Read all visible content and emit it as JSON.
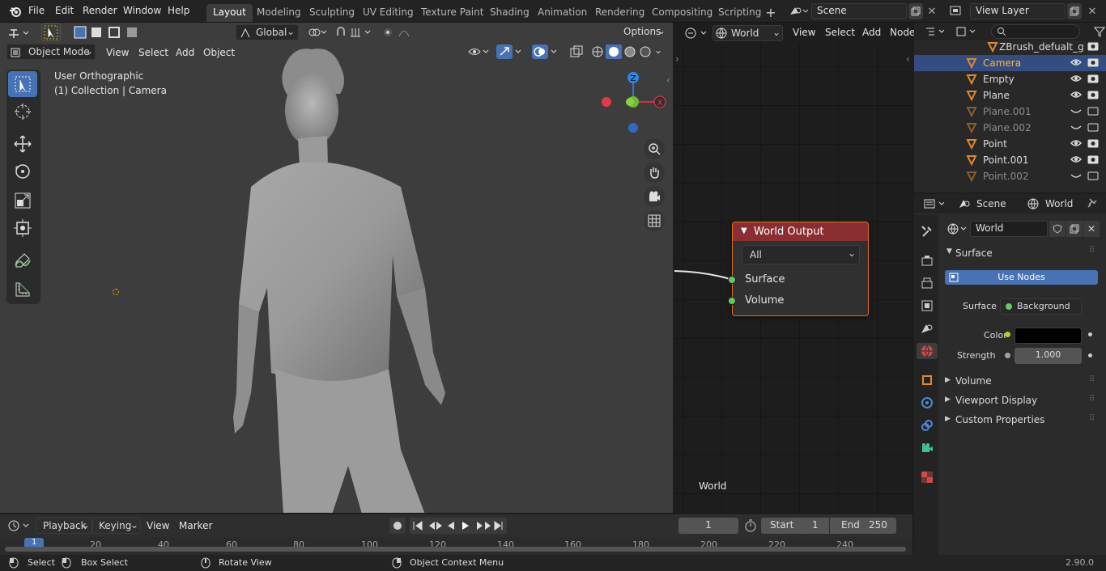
{
  "topbar": {
    "menus": [
      "File",
      "Edit",
      "Render",
      "Window",
      "Help"
    ],
    "workspaces": [
      "Layout",
      "Modeling",
      "Sculpting",
      "UV Editing",
      "Texture Paint",
      "Shading",
      "Animation",
      "Rendering",
      "Compositing",
      "Scripting"
    ],
    "active_workspace": "Layout",
    "scene": "Scene",
    "view_layer": "View Layer"
  },
  "viewport": {
    "transform_orientation": "Global",
    "options_label": "Options",
    "mode": "Object Mode",
    "menus": [
      "View",
      "Select",
      "Add",
      "Object"
    ],
    "view_name": "User Orthographic",
    "collection_info": "(1) Collection | Camera",
    "gizmo_axes": {
      "z": "Z",
      "x": "X"
    }
  },
  "node_editor": {
    "shader_type": "World",
    "menus": [
      "View",
      "Select",
      "Add",
      "Node"
    ],
    "node": {
      "title": "World Output",
      "target": "All",
      "inputs": [
        "Surface",
        "Volume"
      ]
    },
    "footer_label": "World"
  },
  "outliner": {
    "search_placeholder": "",
    "items": [
      {
        "name": "ZBrush_defualt_g",
        "selected": false,
        "dim": false
      },
      {
        "name": "Camera",
        "selected": true,
        "dim": false
      },
      {
        "name": "Empty",
        "selected": false,
        "dim": false
      },
      {
        "name": "Plane",
        "selected": false,
        "dim": false
      },
      {
        "name": "Plane.001",
        "selected": false,
        "dim": true
      },
      {
        "name": "Plane.002",
        "selected": false,
        "dim": true
      },
      {
        "name": "Point",
        "selected": false,
        "dim": false
      },
      {
        "name": "Point.001",
        "selected": false,
        "dim": false
      },
      {
        "name": "Point.002",
        "selected": false,
        "dim": true
      }
    ]
  },
  "properties": {
    "breadcrumb_scene": "Scene",
    "breadcrumb_world": "World",
    "world_name": "World",
    "surface_panel": "Surface",
    "use_nodes_label": "Use Nodes",
    "surface_label": "Surface",
    "surface_value": "Background",
    "color_label": "Color",
    "color_value": "#000000",
    "strength_label": "Strength",
    "strength_value": "1.000",
    "collapsed_panels": [
      "Volume",
      "Viewport Display",
      "Custom Properties"
    ]
  },
  "timeline": {
    "menus": [
      "Playback",
      "Keying",
      "View",
      "Marker"
    ],
    "current_frame": "1",
    "start_label": "Start",
    "start_value": "1",
    "end_label": "End",
    "end_value": "250",
    "ruler": [
      "1",
      "20",
      "40",
      "60",
      "80",
      "100",
      "120",
      "140",
      "160",
      "180",
      "200",
      "220",
      "240"
    ]
  },
  "statusbar": {
    "select": "Select",
    "box_select": "Box Select",
    "rotate_view": "Rotate View",
    "context_menu": "Object Context Menu",
    "version": "2.90.0"
  },
  "colors": {
    "accent_blue": "#4772b3",
    "node_header": "#8b2e31",
    "node_border": "#e07020",
    "socket_green": "#63c763",
    "selection": "#334d80"
  }
}
